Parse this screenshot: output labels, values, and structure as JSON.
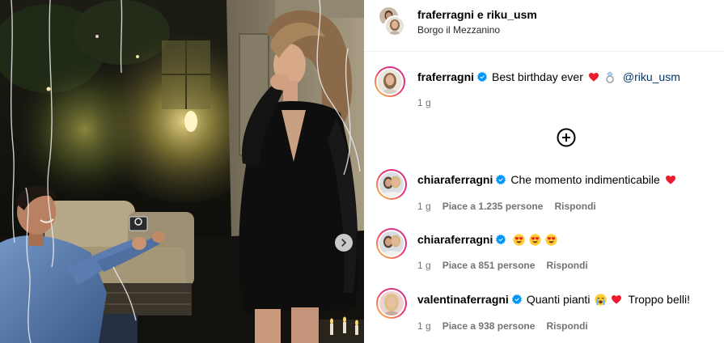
{
  "post": {
    "header": {
      "title": "fraferragni e riku_usm",
      "location": "Borgo il Mezzanino"
    },
    "caption": {
      "username": "fraferragni",
      "verified": true,
      "text": "Best birthday ever",
      "emoji": [
        "red-heart",
        "ring"
      ],
      "mention": "@riku_usm",
      "time": "1 g"
    },
    "comments": [
      {
        "username": "chiaraferragni",
        "verified": true,
        "text": "Che momento indimenticabile",
        "emoji": [
          "red-heart"
        ],
        "time": "1 g",
        "likes": "Piace a 1.235 persone",
        "reply": "Rispondi"
      },
      {
        "username": "chiaraferragni",
        "verified": true,
        "emoji": [
          "heart-eyes",
          "heart-eyes",
          "heart-eyes"
        ],
        "time": "1 g",
        "likes": "Piace a 851 persone",
        "reply": "Rispondi"
      },
      {
        "username": "valentinaferragni",
        "verified": true,
        "text": "Quanti pianti",
        "emoji": [
          "crying-face",
          "red-heart"
        ],
        "text_after": "Troppo belli!",
        "time": "1 g",
        "likes": "Piace a 938 persone",
        "reply": "Rispondi"
      }
    ]
  },
  "icons": {
    "load_more": "plus-circle-icon",
    "next_photo": "chevron-right-icon",
    "verified": "verified-badge-icon"
  },
  "colors": {
    "verified": "#0095f6",
    "mention": "#00376b",
    "meta_text": "#737373",
    "divider": "#efefef",
    "heart": "#ed1c2e"
  }
}
